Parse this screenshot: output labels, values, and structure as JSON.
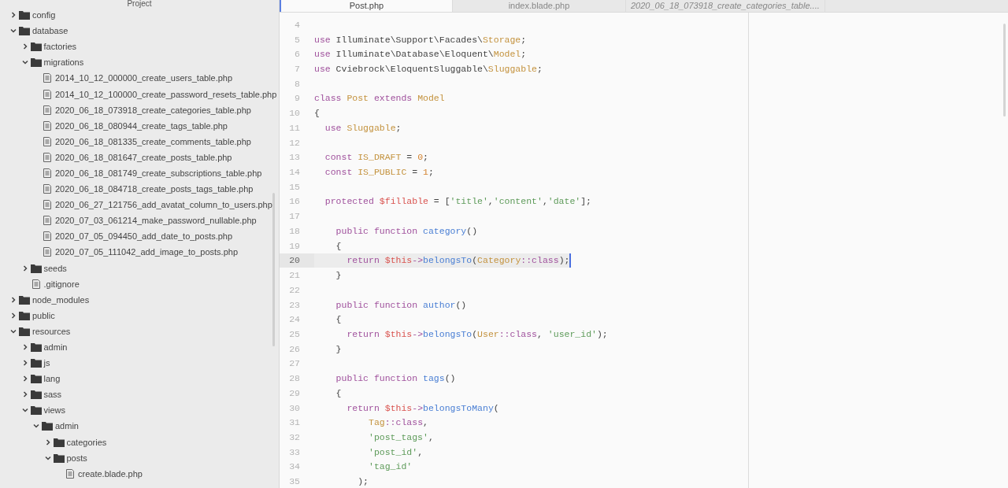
{
  "sidebar": {
    "title": "Project",
    "tree": [
      {
        "kind": "folder",
        "name": "config",
        "expanded": false
      },
      {
        "kind": "folder",
        "name": "database",
        "expanded": true,
        "children": [
          {
            "kind": "folder",
            "name": "factories",
            "expanded": false
          },
          {
            "kind": "folder",
            "name": "migrations",
            "expanded": true,
            "children": [
              {
                "kind": "file",
                "name": "2014_10_12_000000_create_users_table.php"
              },
              {
                "kind": "file",
                "name": "2014_10_12_100000_create_password_resets_table.php"
              },
              {
                "kind": "file",
                "name": "2020_06_18_073918_create_categories_table.php"
              },
              {
                "kind": "file",
                "name": "2020_06_18_080944_create_tags_table.php"
              },
              {
                "kind": "file",
                "name": "2020_06_18_081335_create_comments_table.php"
              },
              {
                "kind": "file",
                "name": "2020_06_18_081647_create_posts_table.php"
              },
              {
                "kind": "file",
                "name": "2020_06_18_081749_create_subscriptions_table.php"
              },
              {
                "kind": "file",
                "name": "2020_06_18_084718_create_posts_tags_table.php"
              },
              {
                "kind": "file",
                "name": "2020_06_27_121756_add_avatat_column_to_users.php"
              },
              {
                "kind": "file",
                "name": "2020_07_03_061214_make_password_nullable.php"
              },
              {
                "kind": "file",
                "name": "2020_07_05_094450_add_date_to_posts.php"
              },
              {
                "kind": "file",
                "name": "2020_07_05_111042_add_image_to_posts.php"
              }
            ]
          },
          {
            "kind": "folder",
            "name": "seeds",
            "expanded": false
          },
          {
            "kind": "file",
            "name": ".gitignore"
          }
        ]
      },
      {
        "kind": "folder",
        "name": "node_modules",
        "expanded": false
      },
      {
        "kind": "folder",
        "name": "public",
        "expanded": false
      },
      {
        "kind": "folder",
        "name": "resources",
        "expanded": true,
        "children": [
          {
            "kind": "folder",
            "name": "admin",
            "expanded": false
          },
          {
            "kind": "folder",
            "name": "js",
            "expanded": false
          },
          {
            "kind": "folder",
            "name": "lang",
            "expanded": false
          },
          {
            "kind": "folder",
            "name": "sass",
            "expanded": false
          },
          {
            "kind": "folder",
            "name": "views",
            "expanded": true,
            "children": [
              {
                "kind": "folder",
                "name": "admin",
                "expanded": true,
                "children": [
                  {
                    "kind": "folder",
                    "name": "categories",
                    "expanded": false
                  },
                  {
                    "kind": "folder",
                    "name": "posts",
                    "expanded": true,
                    "children": [
                      {
                        "kind": "file",
                        "name": "create.blade.php"
                      }
                    ]
                  }
                ]
              }
            ]
          }
        ]
      }
    ]
  },
  "tabs": [
    {
      "label": "Post.php",
      "selected": true,
      "preview": false
    },
    {
      "label": "index.blade.php",
      "selected": false,
      "preview": false
    },
    {
      "label": "2020_06_18_073918_create_categories_table....",
      "selected": false,
      "preview": true
    }
  ],
  "editor": {
    "lines": [
      {
        "number": "4",
        "current": false
      },
      {
        "number": "5",
        "current": false,
        "tokens": [
          {
            "kind": "keyword",
            "text": "use"
          },
          {
            "kind": "plain",
            "text": " Illuminate\\Support\\Facades\\"
          },
          {
            "kind": "type",
            "text": "Storage"
          },
          {
            "kind": "plain",
            "text": ";"
          }
        ]
      },
      {
        "number": "6",
        "current": false,
        "tokens": [
          {
            "kind": "keyword",
            "text": "use"
          },
          {
            "kind": "plain",
            "text": " Illuminate\\Database\\Eloquent\\"
          },
          {
            "kind": "type",
            "text": "Model"
          },
          {
            "kind": "plain",
            "text": ";"
          }
        ]
      },
      {
        "number": "7",
        "current": false,
        "tokens": [
          {
            "kind": "keyword",
            "text": "use"
          },
          {
            "kind": "plain",
            "text": " Cviebrock\\EloquentSluggable\\"
          },
          {
            "kind": "type",
            "text": "Sluggable"
          },
          {
            "kind": "plain",
            "text": ";"
          }
        ]
      },
      {
        "number": "8",
        "current": false
      },
      {
        "number": "9",
        "current": false,
        "tokens": [
          {
            "kind": "keyword",
            "text": "class"
          },
          {
            "kind": "type",
            "text": " Post"
          },
          {
            "kind": "keyword",
            "text": " extends"
          },
          {
            "kind": "type",
            "text": " Model"
          }
        ]
      },
      {
        "number": "10",
        "current": false,
        "tokens": [
          {
            "kind": "plain",
            "text": "{"
          }
        ]
      },
      {
        "number": "11",
        "current": false,
        "tokens": [
          {
            "kind": "keyword",
            "text": "  use"
          },
          {
            "kind": "type",
            "text": " Sluggable"
          },
          {
            "kind": "plain",
            "text": ";"
          }
        ]
      },
      {
        "number": "12",
        "current": false
      },
      {
        "number": "13",
        "current": false,
        "tokens": [
          {
            "kind": "keyword",
            "text": "  const"
          },
          {
            "kind": "type",
            "text": " IS_DRAFT"
          },
          {
            "kind": "plain",
            "text": " = "
          },
          {
            "kind": "number",
            "text": "0"
          },
          {
            "kind": "plain",
            "text": ";"
          }
        ]
      },
      {
        "number": "14",
        "current": false,
        "tokens": [
          {
            "kind": "keyword",
            "text": "  const"
          },
          {
            "kind": "type",
            "text": " IS_PUBLIC"
          },
          {
            "kind": "plain",
            "text": " = "
          },
          {
            "kind": "number",
            "text": "1"
          },
          {
            "kind": "plain",
            "text": ";"
          }
        ]
      },
      {
        "number": "15",
        "current": false
      },
      {
        "number": "16",
        "current": false,
        "tokens": [
          {
            "kind": "keyword",
            "text": "  protected"
          },
          {
            "kind": "variable",
            "text": " $fillable"
          },
          {
            "kind": "plain",
            "text": " = ["
          },
          {
            "kind": "string",
            "text": "'title'"
          },
          {
            "kind": "plain",
            "text": ","
          },
          {
            "kind": "string",
            "text": "'content'"
          },
          {
            "kind": "plain",
            "text": ","
          },
          {
            "kind": "string",
            "text": "'date'"
          },
          {
            "kind": "plain",
            "text": "];"
          }
        ]
      },
      {
        "number": "17",
        "current": false
      },
      {
        "number": "18",
        "current": false,
        "tokens": [
          {
            "kind": "keyword",
            "text": "    public function"
          },
          {
            "kind": "function",
            "text": " category"
          },
          {
            "kind": "plain",
            "text": "()"
          }
        ]
      },
      {
        "number": "19",
        "current": false,
        "tokens": [
          {
            "kind": "plain",
            "text": "    {"
          }
        ]
      },
      {
        "number": "20",
        "current": true,
        "tokens": [
          {
            "kind": "keyword",
            "text": "      return"
          },
          {
            "kind": "variable",
            "text": " $this"
          },
          {
            "kind": "keyword",
            "text": "->"
          },
          {
            "kind": "function",
            "text": "belongsTo"
          },
          {
            "kind": "plain",
            "text": "("
          },
          {
            "kind": "type",
            "text": "Category"
          },
          {
            "kind": "keyword",
            "text": "::class"
          },
          {
            "kind": "plain",
            "text": ");"
          }
        ]
      },
      {
        "number": "21",
        "current": false,
        "tokens": [
          {
            "kind": "plain",
            "text": "    }"
          }
        ]
      },
      {
        "number": "22",
        "current": false
      },
      {
        "number": "23",
        "current": false,
        "tokens": [
          {
            "kind": "keyword",
            "text": "    public function"
          },
          {
            "kind": "function",
            "text": " author"
          },
          {
            "kind": "plain",
            "text": "()"
          }
        ]
      },
      {
        "number": "24",
        "current": false,
        "tokens": [
          {
            "kind": "plain",
            "text": "    {"
          }
        ]
      },
      {
        "number": "25",
        "current": false,
        "tokens": [
          {
            "kind": "keyword",
            "text": "      return"
          },
          {
            "kind": "variable",
            "text": " $this"
          },
          {
            "kind": "keyword",
            "text": "->"
          },
          {
            "kind": "function",
            "text": "belongsTo"
          },
          {
            "kind": "plain",
            "text": "("
          },
          {
            "kind": "type",
            "text": "User"
          },
          {
            "kind": "keyword",
            "text": "::class"
          },
          {
            "kind": "plain",
            "text": ", "
          },
          {
            "kind": "string",
            "text": "'user_id'"
          },
          {
            "kind": "plain",
            "text": ");"
          }
        ]
      },
      {
        "number": "26",
        "current": false,
        "tokens": [
          {
            "kind": "plain",
            "text": "    }"
          }
        ]
      },
      {
        "number": "27",
        "current": false
      },
      {
        "number": "28",
        "current": false,
        "tokens": [
          {
            "kind": "keyword",
            "text": "    public function"
          },
          {
            "kind": "function",
            "text": " tags"
          },
          {
            "kind": "plain",
            "text": "()"
          }
        ]
      },
      {
        "number": "29",
        "current": false,
        "tokens": [
          {
            "kind": "plain",
            "text": "    {"
          }
        ]
      },
      {
        "number": "30",
        "current": false,
        "tokens": [
          {
            "kind": "keyword",
            "text": "      return"
          },
          {
            "kind": "variable",
            "text": " $this"
          },
          {
            "kind": "keyword",
            "text": "->"
          },
          {
            "kind": "function",
            "text": "belongsToMany"
          },
          {
            "kind": "plain",
            "text": "("
          }
        ]
      },
      {
        "number": "31",
        "current": false,
        "tokens": [
          {
            "kind": "type",
            "text": "          Tag"
          },
          {
            "kind": "keyword",
            "text": "::class"
          },
          {
            "kind": "plain",
            "text": ","
          }
        ]
      },
      {
        "number": "32",
        "current": false,
        "tokens": [
          {
            "kind": "string",
            "text": "          'post_tags'"
          },
          {
            "kind": "plain",
            "text": ","
          }
        ]
      },
      {
        "number": "33",
        "current": false,
        "tokens": [
          {
            "kind": "string",
            "text": "          'post_id'"
          },
          {
            "kind": "plain",
            "text": ","
          }
        ]
      },
      {
        "number": "34",
        "current": false,
        "tokens": [
          {
            "kind": "string",
            "text": "          'tag_id'"
          }
        ]
      },
      {
        "number": "35",
        "current": false,
        "tokens": [
          {
            "kind": "plain",
            "text": "        );"
          }
        ]
      }
    ]
  }
}
